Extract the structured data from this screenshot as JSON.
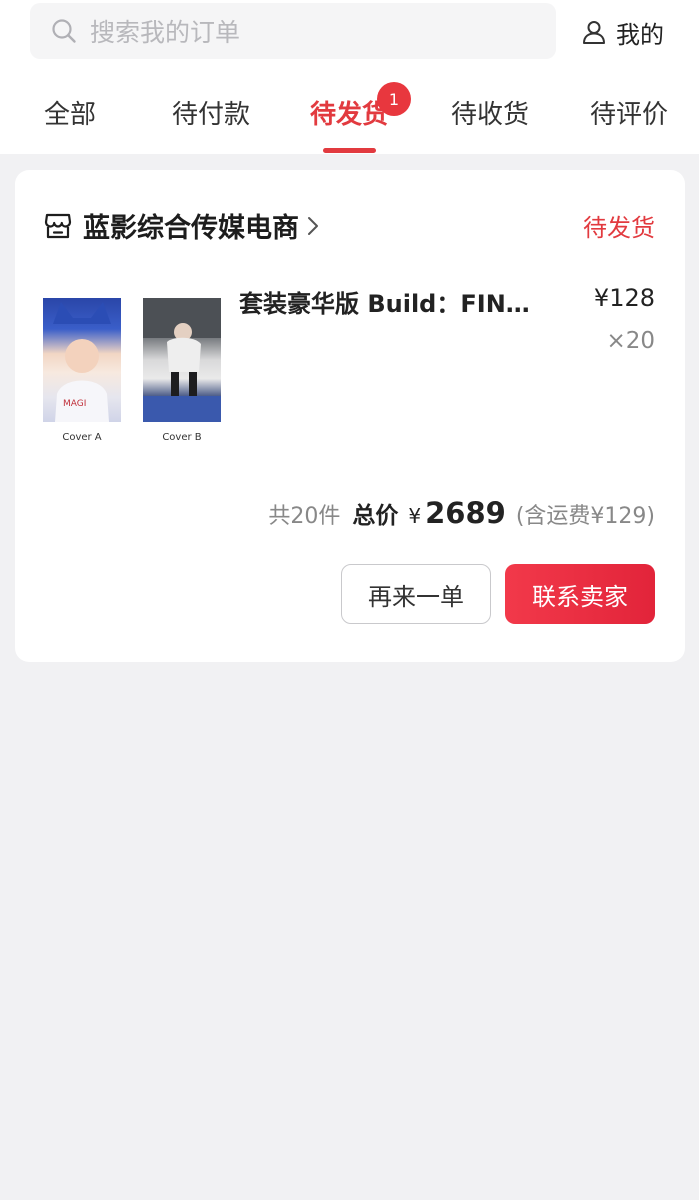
{
  "search": {
    "placeholder": "搜索我的订单",
    "icon": "search-icon"
  },
  "header": {
    "me_label": "我的",
    "me_icon": "user-icon"
  },
  "tabs": [
    {
      "label": "全部",
      "active": false
    },
    {
      "label": "待付款",
      "active": false
    },
    {
      "label": "待发货",
      "active": true,
      "badge": "1"
    },
    {
      "label": "待收货",
      "active": false
    },
    {
      "label": "待评价",
      "active": false
    }
  ],
  "order": {
    "shop_icon": "store-icon",
    "shop_name": "蓝影综合传媒电商",
    "status": "待发货",
    "item": {
      "title": "套装豪华版 Build：FIN…",
      "price": "¥128",
      "quantity": "×20",
      "thumbnails": [
        {
          "caption": "Cover A"
        },
        {
          "caption": "Cover B"
        }
      ]
    },
    "summary": {
      "count": "共20件",
      "total_label": "总价",
      "currency": "¥",
      "amount": "2689",
      "shipping": "(含运费¥129)"
    },
    "buttons": {
      "again": "再来一单",
      "contact": "联系卖家"
    }
  },
  "colors": {
    "accent": "#e23a3f",
    "background": "#f1f1f3",
    "card": "#ffffff"
  }
}
